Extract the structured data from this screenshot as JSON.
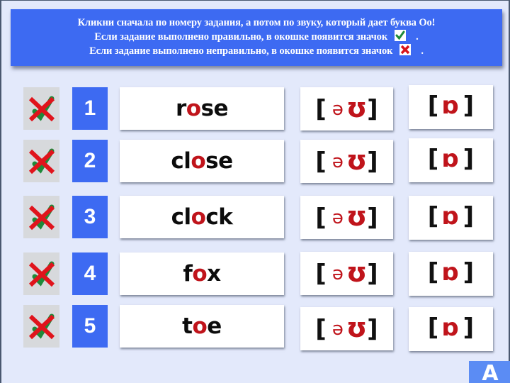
{
  "instructions": {
    "line1": "Кликни сначала по номеру задания, а потом по звуку, который дает буква Оо!",
    "line2_before": "Если задание выполнено правильно, в окошке появится значок",
    "line2_after": ".",
    "line3_before": "Если задание выполнено неправильно, в окошке появится значок",
    "line3_after": ".",
    "correct_icon": "check-icon",
    "wrong_icon": "cross-icon"
  },
  "colors": {
    "accent": "#3d6af2",
    "highlight": "#c0141b",
    "background": "#e3e9fb"
  },
  "tasks": [
    {
      "number": "1",
      "word_before": "r",
      "word_letter": "o",
      "word_after": "se",
      "status": "cross-over-check"
    },
    {
      "number": "2",
      "word_before": "cl",
      "word_letter": "o",
      "word_after": "se",
      "status": "cross-over-check"
    },
    {
      "number": "3",
      "word_before": "cl",
      "word_letter": "o",
      "word_after": "ck",
      "status": "cross-over-check"
    },
    {
      "number": "4",
      "word_before": "f",
      "word_letter": "o",
      "word_after": "x",
      "status": "cross-over-check"
    },
    {
      "number": "5",
      "word_before": "t",
      "word_letter": "o",
      "word_after": "e",
      "status": "cross-over-check"
    }
  ],
  "sounds": {
    "open_bracket": "[",
    "close_bracket": "]",
    "diphthong_first": "ə",
    "diphthong_second": "ʊ",
    "short_o": "ɒ"
  },
  "corner_button": "A"
}
